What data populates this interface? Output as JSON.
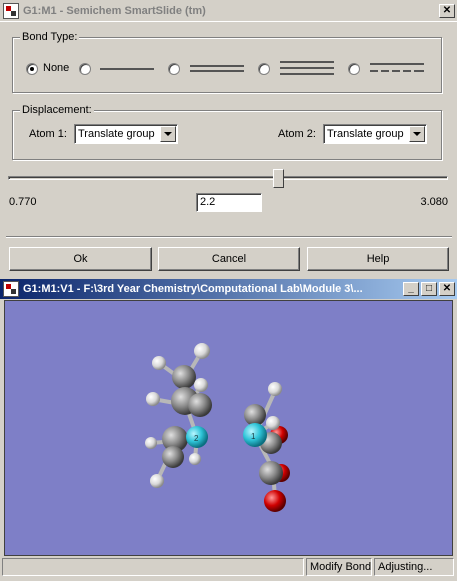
{
  "dialog": {
    "title": "G1:M1 - Semichem SmartSlide (tm)",
    "close_label": "✕",
    "bond_type": {
      "legend": "Bond Type:",
      "options": [
        {
          "label": "None",
          "selected": true,
          "style": "none"
        },
        {
          "label": "",
          "selected": false,
          "style": "single"
        },
        {
          "label": "",
          "selected": false,
          "style": "double"
        },
        {
          "label": "",
          "selected": false,
          "style": "triple"
        },
        {
          "label": "",
          "selected": false,
          "style": "dashed"
        }
      ]
    },
    "displacement": {
      "legend": "Displacement:",
      "atom1_label": "Atom 1:",
      "atom1_value": "Translate group",
      "atom2_label": "Atom 2:",
      "atom2_value": "Translate group"
    },
    "slider": {
      "min_label": "0.770",
      "max_label": "3.080",
      "value": "2.2",
      "fraction": 0.618
    },
    "buttons": {
      "ok": "Ok",
      "cancel": "Cancel",
      "help": "Help"
    }
  },
  "viewer": {
    "title": "G1:M1:V1 - F:\\3rd Year Chemistry\\Computational Lab\\Module 3\\...",
    "minimize_label": "_",
    "maximize_label": "□",
    "close_label": "✕",
    "background_color": "#7e7fc7",
    "atom_labels": {
      "atom2": "2",
      "atom1": "1"
    },
    "colors": {
      "carbon": "#8a8a8a",
      "hydrogen": "#e8e8e8",
      "nitrogen": "#2ec4d8",
      "oxygen": "#d00000"
    }
  },
  "status": {
    "panel1": "",
    "panel2": "Modify Bond",
    "panel3": "Adjusting..."
  }
}
